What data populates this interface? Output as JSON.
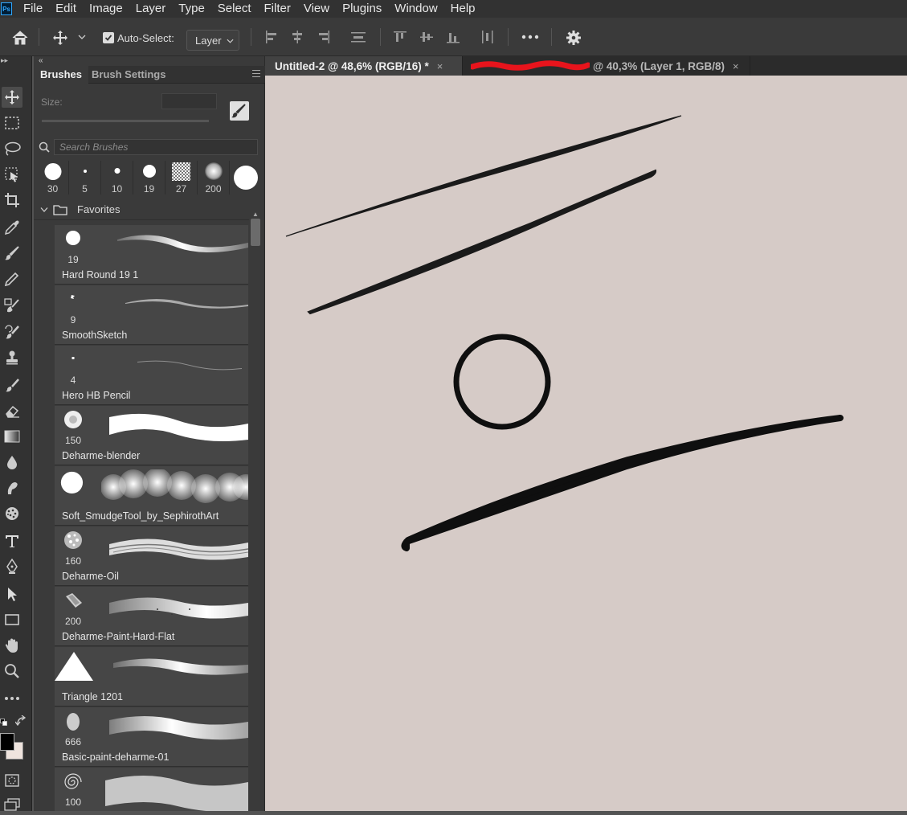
{
  "app": {
    "logo": "Ps"
  },
  "menu": [
    "File",
    "Edit",
    "Image",
    "Layer",
    "Type",
    "Select",
    "Filter",
    "View",
    "Plugins",
    "Window",
    "Help"
  ],
  "options": {
    "auto_select_label": "Auto-Select:",
    "auto_select_checked": true,
    "layer_select_value": "Layer"
  },
  "tabs": [
    {
      "title": "Untitled-2 @ 48,6% (RGB/16) *",
      "close": "×",
      "active": true
    },
    {
      "title": "@ 40,3% (Layer 1, RGB/8)",
      "close": "×",
      "active": false,
      "redacted": true
    }
  ],
  "panel": {
    "collapse_glyph": "«",
    "tabs": [
      "Brushes",
      "Brush Settings"
    ],
    "size_label": "Size:",
    "search_placeholder": "Search Brushes",
    "presets": [
      "30",
      "5",
      "10",
      "19",
      "27",
      "200",
      ""
    ],
    "folder_name": "Favorites",
    "brushes": [
      {
        "size": "19",
        "name": "Hard Round 19 1"
      },
      {
        "size": "9",
        "name": "SmoothSketch"
      },
      {
        "size": "4",
        "name": "Hero HB Pencil"
      },
      {
        "size": "150",
        "name": "Deharme-blender"
      },
      {
        "size": "",
        "name": "Soft_SmudgeTool_by_SephirothArt"
      },
      {
        "size": "160",
        "name": "Deharme-Oil"
      },
      {
        "size": "200",
        "name": "Deharme-Paint-Hard-Flat"
      },
      {
        "size": "",
        "name": "Triangle 1201"
      },
      {
        "size": "666",
        "name": "Basic-paint-deharme-01"
      },
      {
        "size": "100",
        "name": ""
      }
    ]
  },
  "colors": {
    "foreground": "#000000",
    "background": "#efe4de",
    "canvas": "#d6cbc7",
    "redaction": "#e8141c"
  }
}
